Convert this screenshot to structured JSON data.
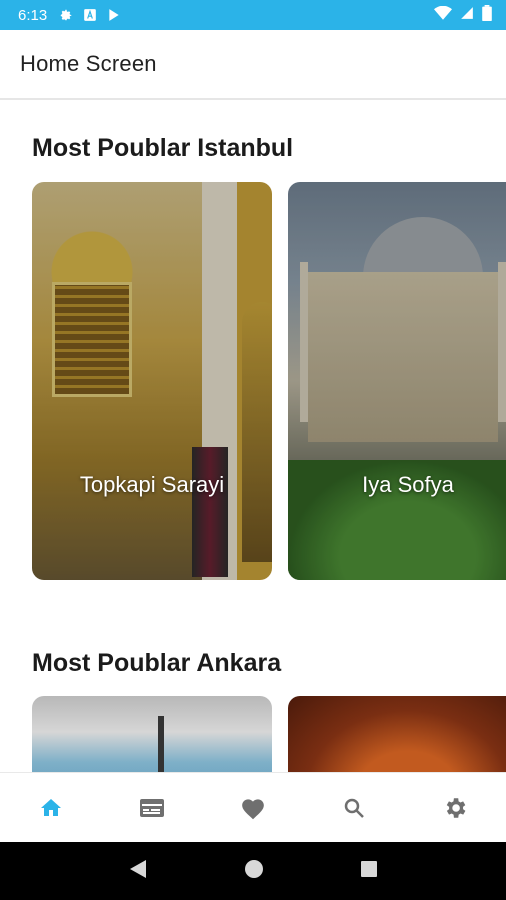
{
  "status_bar": {
    "time": "6:13"
  },
  "app_bar": {
    "title": "Home Screen"
  },
  "sections": [
    {
      "title": "Most Poublar Istanbul",
      "cards": [
        {
          "label": "Topkapi Sarayi"
        },
        {
          "label": "Iya Sofya"
        }
      ]
    },
    {
      "title": "Most Poublar Ankara",
      "cards": [
        {
          "label": ""
        },
        {
          "label": ""
        }
      ]
    }
  ],
  "bottom_nav": {
    "items": [
      {
        "icon": "home-icon",
        "active": true
      },
      {
        "icon": "card-icon",
        "active": false
      },
      {
        "icon": "heart-icon",
        "active": false
      },
      {
        "icon": "search-icon",
        "active": false
      },
      {
        "icon": "settings-icon",
        "active": false
      }
    ]
  },
  "colors": {
    "status_bar": "#2bb3e8",
    "accent": "#2bb3e8",
    "nav_inactive": "#6f6f6f"
  }
}
